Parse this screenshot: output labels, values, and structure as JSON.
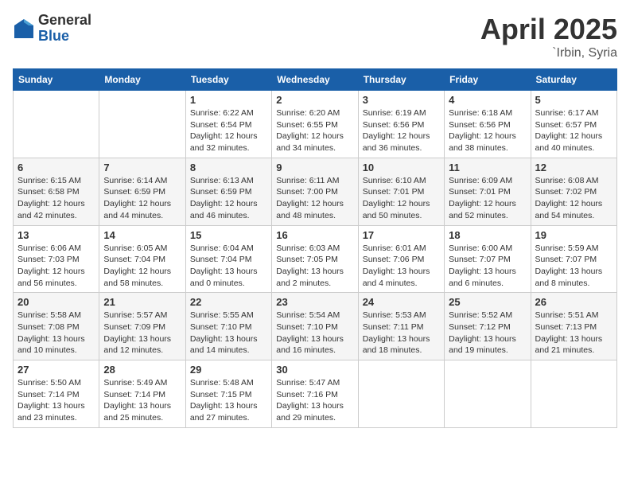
{
  "header": {
    "logo_general": "General",
    "logo_blue": "Blue",
    "title": "April 2025",
    "location": "`Irbin, Syria"
  },
  "days_of_week": [
    "Sunday",
    "Monday",
    "Tuesday",
    "Wednesday",
    "Thursday",
    "Friday",
    "Saturday"
  ],
  "weeks": [
    [
      {
        "day": "",
        "info": ""
      },
      {
        "day": "",
        "info": ""
      },
      {
        "day": "1",
        "info": "Sunrise: 6:22 AM\nSunset: 6:54 PM\nDaylight: 12 hours\nand 32 minutes."
      },
      {
        "day": "2",
        "info": "Sunrise: 6:20 AM\nSunset: 6:55 PM\nDaylight: 12 hours\nand 34 minutes."
      },
      {
        "day": "3",
        "info": "Sunrise: 6:19 AM\nSunset: 6:56 PM\nDaylight: 12 hours\nand 36 minutes."
      },
      {
        "day": "4",
        "info": "Sunrise: 6:18 AM\nSunset: 6:56 PM\nDaylight: 12 hours\nand 38 minutes."
      },
      {
        "day": "5",
        "info": "Sunrise: 6:17 AM\nSunset: 6:57 PM\nDaylight: 12 hours\nand 40 minutes."
      }
    ],
    [
      {
        "day": "6",
        "info": "Sunrise: 6:15 AM\nSunset: 6:58 PM\nDaylight: 12 hours\nand 42 minutes."
      },
      {
        "day": "7",
        "info": "Sunrise: 6:14 AM\nSunset: 6:59 PM\nDaylight: 12 hours\nand 44 minutes."
      },
      {
        "day": "8",
        "info": "Sunrise: 6:13 AM\nSunset: 6:59 PM\nDaylight: 12 hours\nand 46 minutes."
      },
      {
        "day": "9",
        "info": "Sunrise: 6:11 AM\nSunset: 7:00 PM\nDaylight: 12 hours\nand 48 minutes."
      },
      {
        "day": "10",
        "info": "Sunrise: 6:10 AM\nSunset: 7:01 PM\nDaylight: 12 hours\nand 50 minutes."
      },
      {
        "day": "11",
        "info": "Sunrise: 6:09 AM\nSunset: 7:01 PM\nDaylight: 12 hours\nand 52 minutes."
      },
      {
        "day": "12",
        "info": "Sunrise: 6:08 AM\nSunset: 7:02 PM\nDaylight: 12 hours\nand 54 minutes."
      }
    ],
    [
      {
        "day": "13",
        "info": "Sunrise: 6:06 AM\nSunset: 7:03 PM\nDaylight: 12 hours\nand 56 minutes."
      },
      {
        "day": "14",
        "info": "Sunrise: 6:05 AM\nSunset: 7:04 PM\nDaylight: 12 hours\nand 58 minutes."
      },
      {
        "day": "15",
        "info": "Sunrise: 6:04 AM\nSunset: 7:04 PM\nDaylight: 13 hours\nand 0 minutes."
      },
      {
        "day": "16",
        "info": "Sunrise: 6:03 AM\nSunset: 7:05 PM\nDaylight: 13 hours\nand 2 minutes."
      },
      {
        "day": "17",
        "info": "Sunrise: 6:01 AM\nSunset: 7:06 PM\nDaylight: 13 hours\nand 4 minutes."
      },
      {
        "day": "18",
        "info": "Sunrise: 6:00 AM\nSunset: 7:07 PM\nDaylight: 13 hours\nand 6 minutes."
      },
      {
        "day": "19",
        "info": "Sunrise: 5:59 AM\nSunset: 7:07 PM\nDaylight: 13 hours\nand 8 minutes."
      }
    ],
    [
      {
        "day": "20",
        "info": "Sunrise: 5:58 AM\nSunset: 7:08 PM\nDaylight: 13 hours\nand 10 minutes."
      },
      {
        "day": "21",
        "info": "Sunrise: 5:57 AM\nSunset: 7:09 PM\nDaylight: 13 hours\nand 12 minutes."
      },
      {
        "day": "22",
        "info": "Sunrise: 5:55 AM\nSunset: 7:10 PM\nDaylight: 13 hours\nand 14 minutes."
      },
      {
        "day": "23",
        "info": "Sunrise: 5:54 AM\nSunset: 7:10 PM\nDaylight: 13 hours\nand 16 minutes."
      },
      {
        "day": "24",
        "info": "Sunrise: 5:53 AM\nSunset: 7:11 PM\nDaylight: 13 hours\nand 18 minutes."
      },
      {
        "day": "25",
        "info": "Sunrise: 5:52 AM\nSunset: 7:12 PM\nDaylight: 13 hours\nand 19 minutes."
      },
      {
        "day": "26",
        "info": "Sunrise: 5:51 AM\nSunset: 7:13 PM\nDaylight: 13 hours\nand 21 minutes."
      }
    ],
    [
      {
        "day": "27",
        "info": "Sunrise: 5:50 AM\nSunset: 7:14 PM\nDaylight: 13 hours\nand 23 minutes."
      },
      {
        "day": "28",
        "info": "Sunrise: 5:49 AM\nSunset: 7:14 PM\nDaylight: 13 hours\nand 25 minutes."
      },
      {
        "day": "29",
        "info": "Sunrise: 5:48 AM\nSunset: 7:15 PM\nDaylight: 13 hours\nand 27 minutes."
      },
      {
        "day": "30",
        "info": "Sunrise: 5:47 AM\nSunset: 7:16 PM\nDaylight: 13 hours\nand 29 minutes."
      },
      {
        "day": "",
        "info": ""
      },
      {
        "day": "",
        "info": ""
      },
      {
        "day": "",
        "info": ""
      }
    ]
  ]
}
